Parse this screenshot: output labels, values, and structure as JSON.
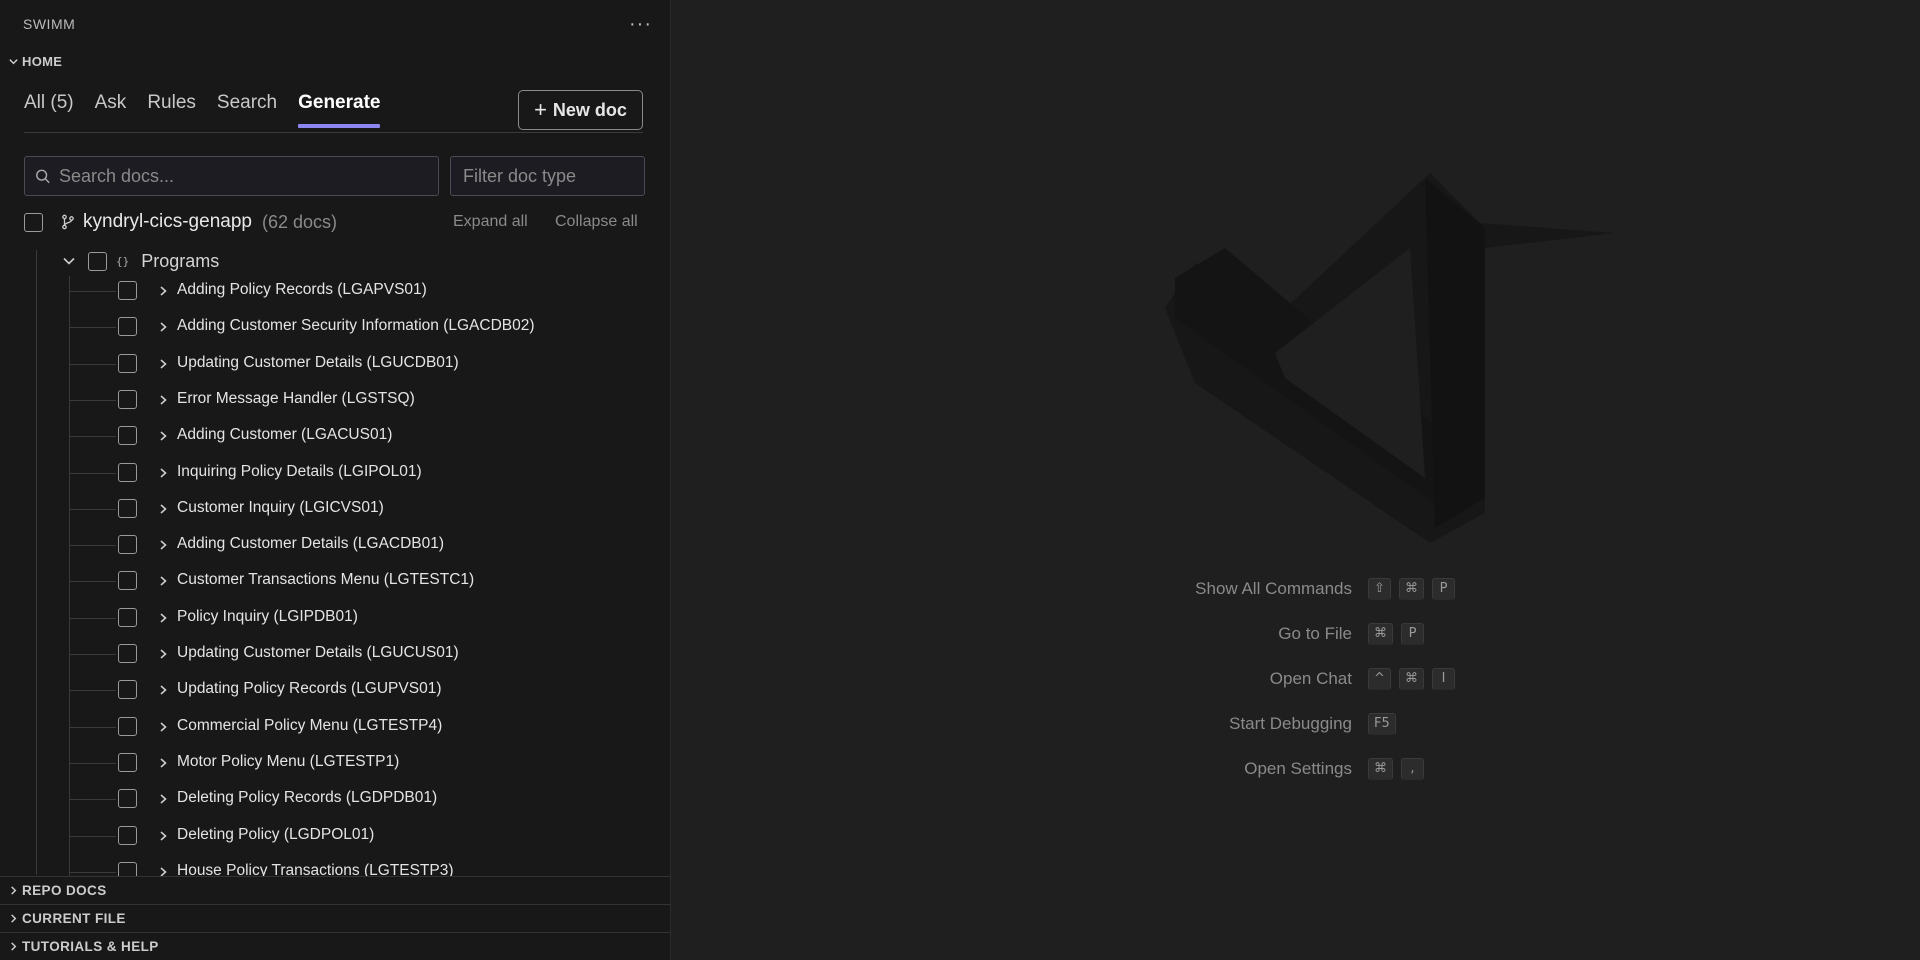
{
  "panel": {
    "title": "SWIMM",
    "more_label": "···"
  },
  "home_section": {
    "label": "HOME"
  },
  "tabs": [
    {
      "label": "All (5)",
      "active": false
    },
    {
      "label": "Ask",
      "active": false
    },
    {
      "label": "Rules",
      "active": false
    },
    {
      "label": "Search",
      "active": false
    },
    {
      "label": "Generate",
      "active": true
    }
  ],
  "new_doc": {
    "plus": "+",
    "label": "New doc"
  },
  "search": {
    "placeholder": "Search docs..."
  },
  "filter": {
    "placeholder": "Filter doc type"
  },
  "repo": {
    "name": "kyndryl-cics-genapp",
    "count": "(62 docs)",
    "expand_all": "Expand all",
    "collapse_all": "Collapse all"
  },
  "programs": {
    "braces": "{}",
    "label": "Programs"
  },
  "items": [
    "Adding Policy Records (LGAPVS01)",
    "Adding Customer Security Information (LGACDB02)",
    "Updating Customer Details (LGUCDB01)",
    "Error Message Handler (LGSTSQ)",
    "Adding Customer (LGACUS01)",
    "Inquiring Policy Details (LGIPOL01)",
    "Customer Inquiry (LGICVS01)",
    "Adding Customer Details (LGACDB01)",
    "Customer Transactions Menu (LGTESTC1)",
    "Policy Inquiry (LGIPDB01)",
    "Updating Customer Details (LGUCUS01)",
    "Updating Policy Records (LGUPVS01)",
    "Commercial Policy Menu (LGTESTP4)",
    "Motor Policy Menu (LGTESTP1)",
    "Deleting Policy Records (LGDPDB01)",
    "Deleting Policy (LGDPOL01)",
    "House Policy Transactions (LGTESTP3)"
  ],
  "bottom_sections": [
    {
      "label": "REPO DOCS"
    },
    {
      "label": "CURRENT FILE"
    },
    {
      "label": "TUTORIALS & HELP"
    }
  ],
  "shortcuts": [
    {
      "label": "Show All Commands",
      "keys": [
        "⇧",
        "⌘",
        "P"
      ]
    },
    {
      "label": "Go to File",
      "keys": [
        "⌘",
        "P"
      ]
    },
    {
      "label": "Open Chat",
      "keys": [
        "^",
        "⌘",
        "I"
      ]
    },
    {
      "label": "Start Debugging",
      "keys": [
        "F5"
      ]
    },
    {
      "label": "Open Settings",
      "keys": [
        "⌘",
        ","
      ]
    }
  ]
}
